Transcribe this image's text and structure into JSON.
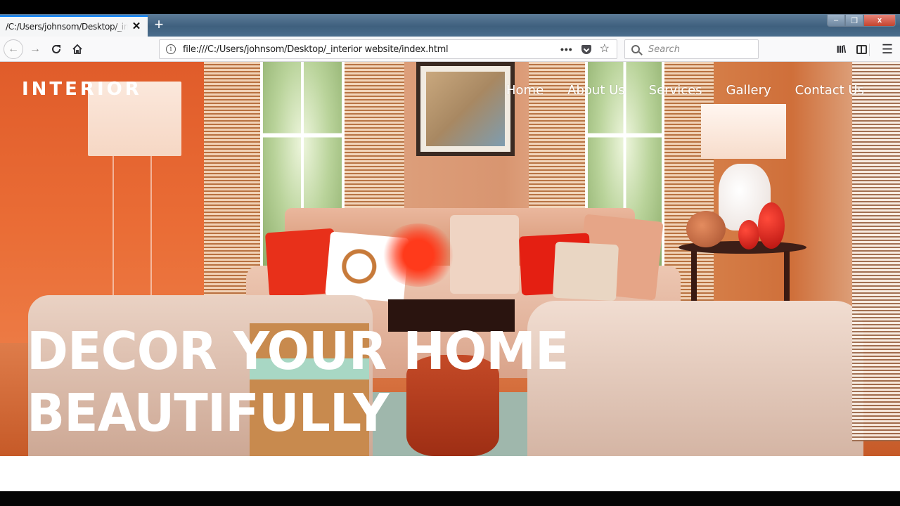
{
  "browser": {
    "tab": {
      "title": "/C:/Users/johnsom/Desktop/_interior website/index.html",
      "close_icon": "close-icon"
    },
    "new_tab_label": "+",
    "window_controls": {
      "minimize": "–",
      "maximize": "❐",
      "close": "x"
    },
    "nav": {
      "back_icon": "←",
      "forward_icon": "→",
      "reload_icon": "C",
      "home_icon": "⌂"
    },
    "url": {
      "info_icon": "i",
      "value": "file:///C:/Users/johnsom/Desktop/_interior website/index.html",
      "more_icon": "•••",
      "bookmark_icon": "☆"
    },
    "search": {
      "placeholder": "Search"
    },
    "toolbar_right": {
      "library_icon": "III\\",
      "menu_icon": "☰"
    }
  },
  "site": {
    "logo": "INTERIOR",
    "nav": [
      {
        "label": "Home"
      },
      {
        "label": "About Us"
      },
      {
        "label": "Services"
      },
      {
        "label": "Gallery"
      },
      {
        "label": "Contact Us"
      }
    ],
    "hero": {
      "line1": "Decor your home",
      "line2": "Beautifully"
    }
  }
}
